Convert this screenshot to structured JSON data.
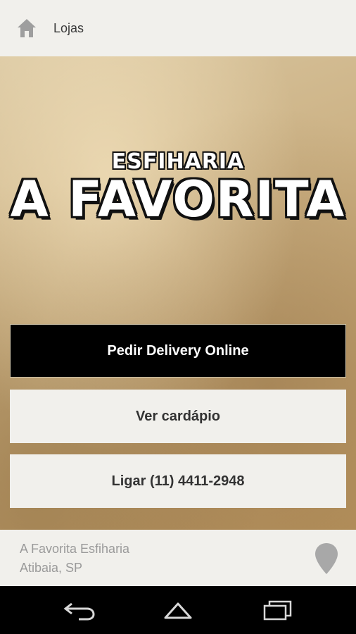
{
  "header": {
    "title": "Lojas"
  },
  "logo": {
    "subtitle": "ESFIHARIA",
    "title": "A FAVORITA"
  },
  "actions": {
    "delivery_label": "Pedir Delivery Online",
    "menu_label": "Ver cardápio",
    "call_label": "Ligar (11) 4411-2948"
  },
  "footer": {
    "store_name": "A Favorita Esfiharia",
    "store_city": "Atibaia, SP"
  },
  "icons": {
    "home": "home-icon",
    "location": "location-pin-icon",
    "back": "back-icon",
    "nav_home": "nav-home-icon",
    "recents": "recents-icon"
  },
  "colors": {
    "primary_button": "#000000",
    "secondary_button": "#f1f0ec",
    "header_bg": "#f1f0ec",
    "footer_text": "#9a9a9a"
  }
}
